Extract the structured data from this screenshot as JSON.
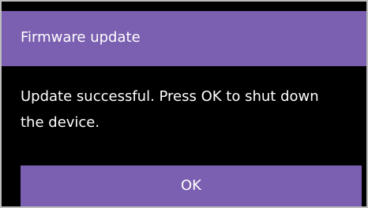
{
  "dialog": {
    "title": "Firmware update",
    "message": "Update successful. Press OK to shut down the device.",
    "ok_label": "OK"
  },
  "colors": {
    "accent": "#7B5FB0",
    "background": "#000000",
    "text": "#FFFFFF"
  }
}
